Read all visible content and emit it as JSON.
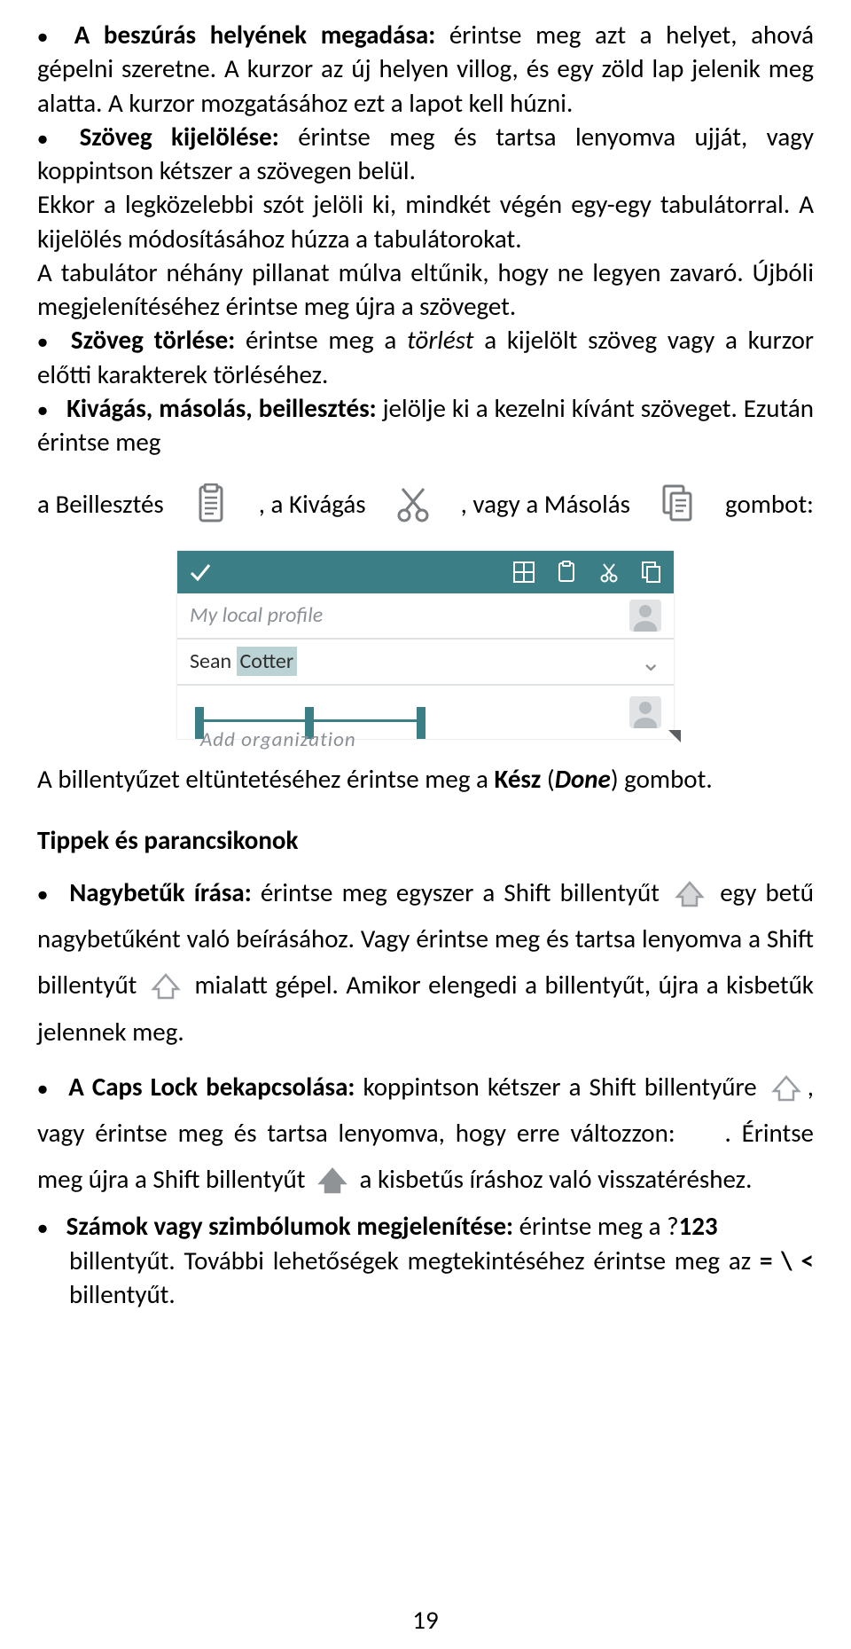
{
  "b1": {
    "title": "A beszúrás helyének megadása:",
    "text": "érintse meg azt a helyet, ahová gépelni szeretne. A kurzor az új helyen villog, és egy zöld lap jelenik meg alatta. A kurzor mozgatásához ezt a lapot kell húzni."
  },
  "b2": {
    "title": "Szöveg kijelölése:",
    "text": "érintse meg és tartsa lenyomva ujját, vagy koppintson kétszer a szövegen belül.",
    "line2": "Ekkor a legközelebbi szót jelöli ki, mindkét végén egy-egy tabulátorral. A kijelölés módosításához húzza a tabulátorokat.",
    "line3": "A tabulátor néhány pillanat múlva eltűnik, hogy ne legyen zavaró. Újbóli megjelenítéséhez érintse meg újra a szöveget."
  },
  "b3": {
    "title": "Szöveg törlése:",
    "t1": "érintse meg a",
    "it": "törlést",
    "t2": "a kijelölt szöveg vagy a kurzor előtti karakterek törléséhez."
  },
  "b4": {
    "title": "Kivágás, másolás, beillesztés:",
    "t1": "jelölje ki a kezelni kívánt szöveget. Ezután érintse meg"
  },
  "iconline": {
    "t1": "a Beillesztés",
    "t2": ", a Kivágás",
    "t3": ", vagy a Másolás",
    "t4": "gombot:"
  },
  "mock": {
    "row1": "My local profile",
    "row2a": "Sean ",
    "row2b": "Cotter",
    "row3": "Add organization"
  },
  "after_mock": {
    "t1": "A billentyűzet eltüntetéséhez érintse meg a ",
    "b": "Kész",
    "p1": " (",
    "it": "Done",
    "p2": ") gombot."
  },
  "sect_title": "Tippek és parancsikonok",
  "b5": {
    "title": "Nagybetűk írása:",
    "t1": "érintse meg egyszer a Shift billentyűt",
    "t2": "egy betű nagybetűként való beírásához. Vagy érintse meg és tartsa lenyomva a Shift billentyűt",
    "t3": "mialatt gépel. Amikor elengedi a billentyűt, újra a kisbetűk jelennek meg."
  },
  "b6": {
    "title": "A Caps Lock bekapcsolása:",
    "t1": "koppintson kétszer a Shift billentyűre",
    "t2": ", vagy érintse meg és tartsa lenyomva, hogy erre változzon:",
    "t3": ". Érintse meg újra a Shift billentyűt",
    "t4": "a kisbetűs íráshoz való visszatéréshez."
  },
  "b7": {
    "title": "Számok vagy szimbólumok megjelenítése:",
    "t1": "érintse meg a ?",
    "b1": "123",
    "t2": "billentyűt. További lehetőségek megtekintéséhez érintse meg az",
    "b2": "= \\ <",
    "t3": " billentyűt."
  },
  "page_number": "19"
}
